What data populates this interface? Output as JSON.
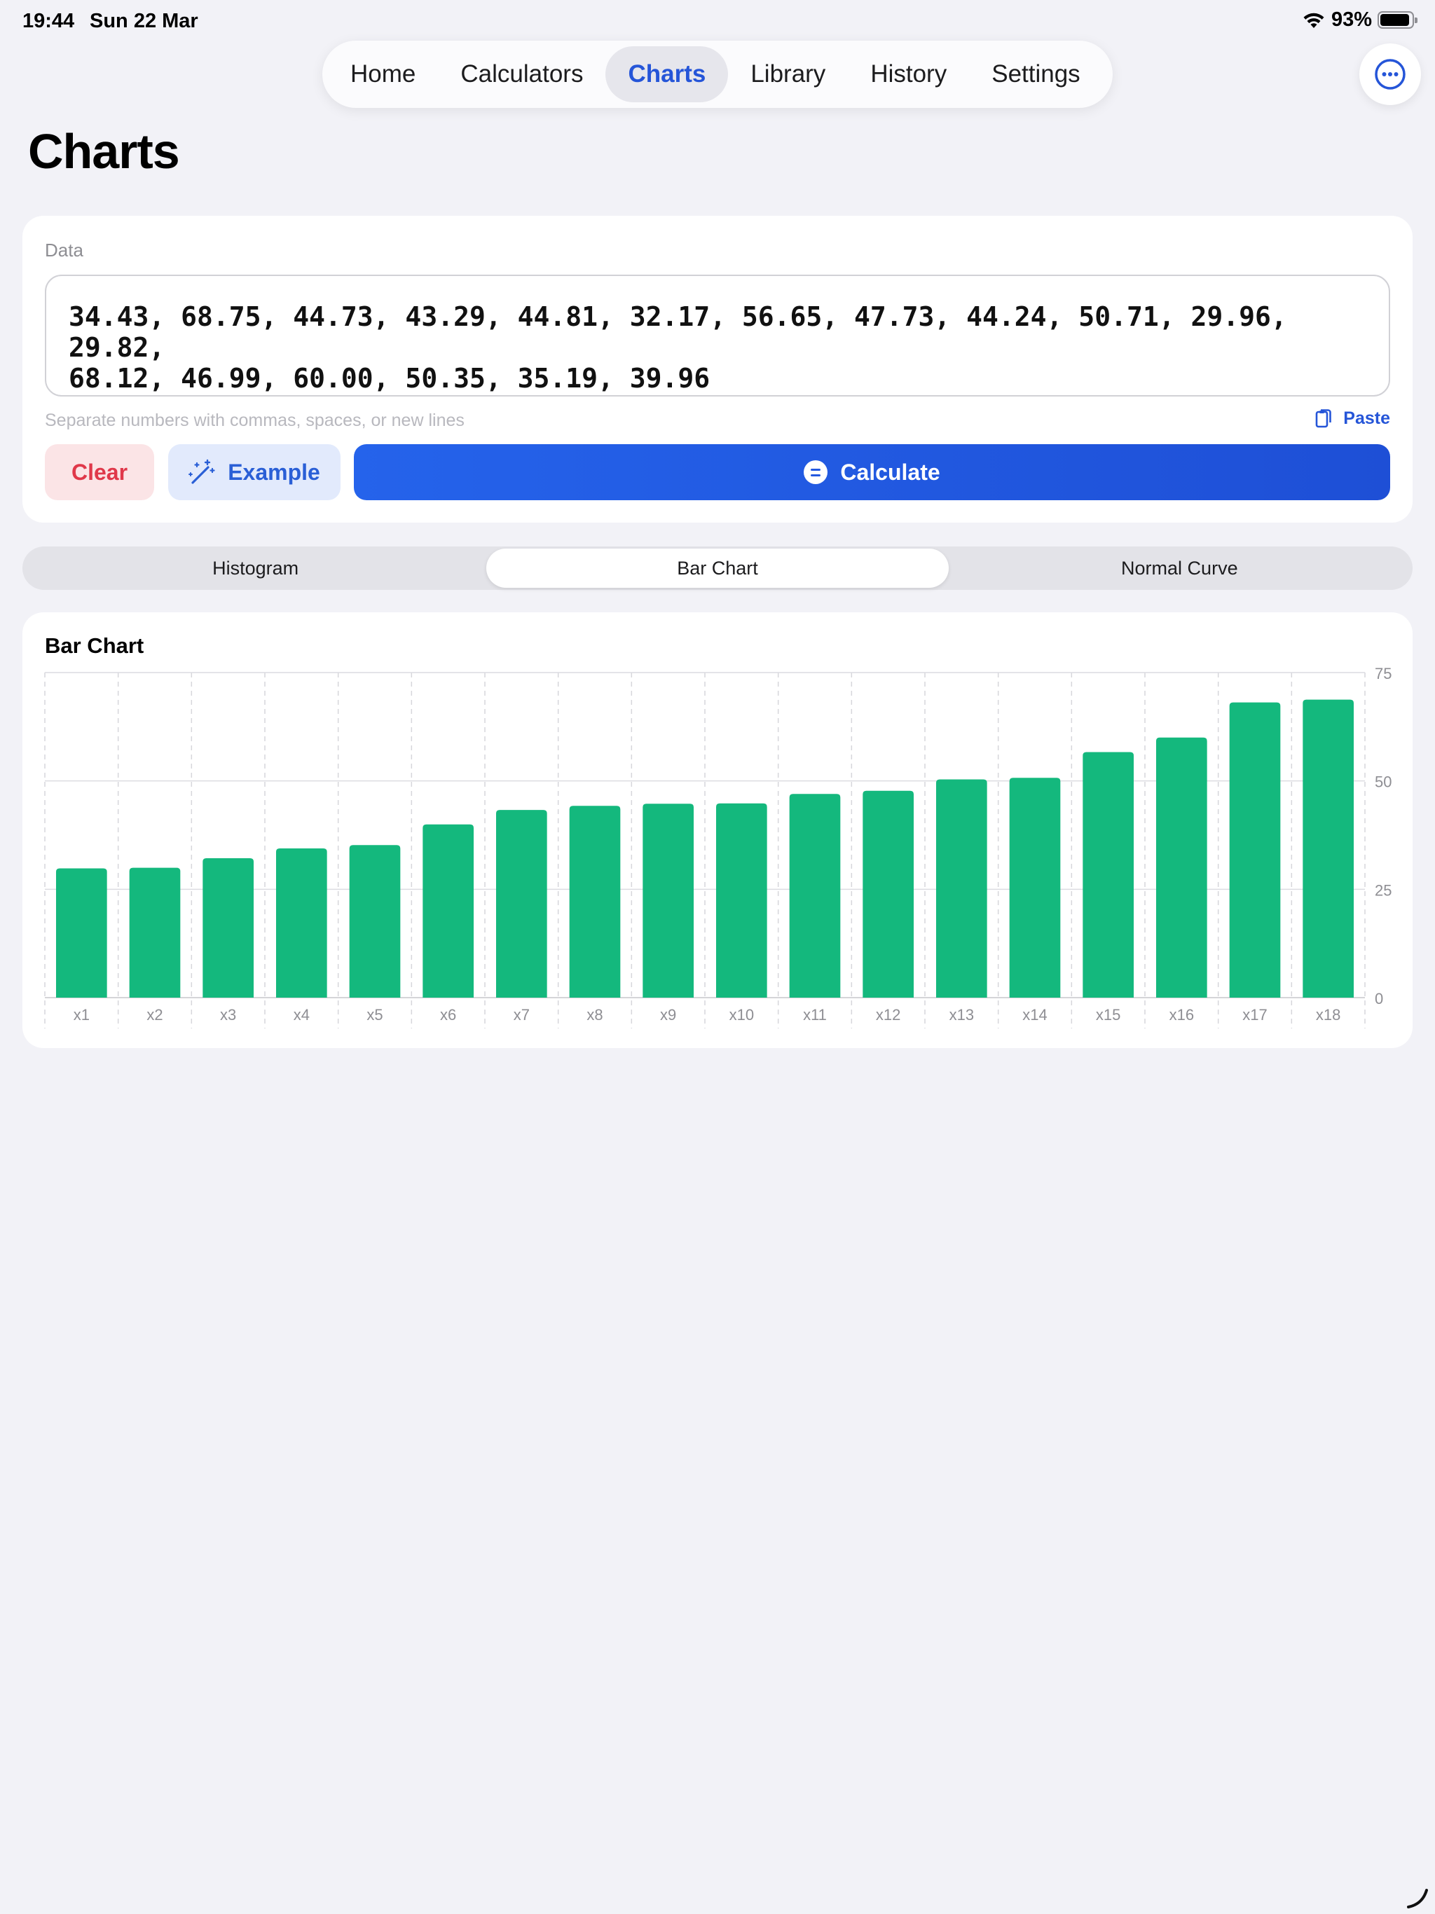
{
  "status": {
    "time": "19:44",
    "date": "Sun 22 Mar",
    "battery": "93%"
  },
  "nav": {
    "tabs": [
      {
        "label": "Home"
      },
      {
        "label": "Calculators"
      },
      {
        "label": "Charts",
        "active": true
      },
      {
        "label": "Library"
      },
      {
        "label": "History"
      },
      {
        "label": "Settings"
      }
    ],
    "more_icon": "ellipsis-circle-icon"
  },
  "page": {
    "title": "Charts"
  },
  "data_card": {
    "label": "Data",
    "value": "34.43, 68.75, 44.73, 43.29, 44.81, 32.17, 56.65, 47.73, 44.24, 50.71, 29.96, 29.82,\n68.12, 46.99, 60.00, 50.35, 35.19, 39.96",
    "hint": "Separate numbers with commas, spaces, or new lines",
    "paste_label": "Paste",
    "clear_label": "Clear",
    "example_label": "Example",
    "calculate_label": "Calculate"
  },
  "segments": {
    "items": [
      "Histogram",
      "Bar Chart",
      "Normal Curve"
    ],
    "selected": "Bar Chart"
  },
  "chart_data": {
    "type": "bar",
    "title": "Bar Chart",
    "categories": [
      "x1",
      "x2",
      "x3",
      "x4",
      "x5",
      "x6",
      "x7",
      "x8",
      "x9",
      "x10",
      "x11",
      "x12",
      "x13",
      "x14",
      "x15",
      "x16",
      "x17",
      "x18"
    ],
    "values": [
      29.82,
      29.96,
      32.17,
      34.43,
      35.19,
      39.96,
      43.29,
      44.24,
      44.73,
      44.81,
      46.99,
      47.73,
      50.35,
      50.71,
      56.65,
      60.0,
      68.12,
      68.75
    ],
    "ylim": [
      0,
      75
    ],
    "yticks": [
      0,
      25,
      50,
      75
    ],
    "ytick_labels": [
      "0",
      "25",
      "50",
      "75"
    ],
    "y_axis_side": "right",
    "grid": true,
    "bar_color": "#14b87d"
  }
}
